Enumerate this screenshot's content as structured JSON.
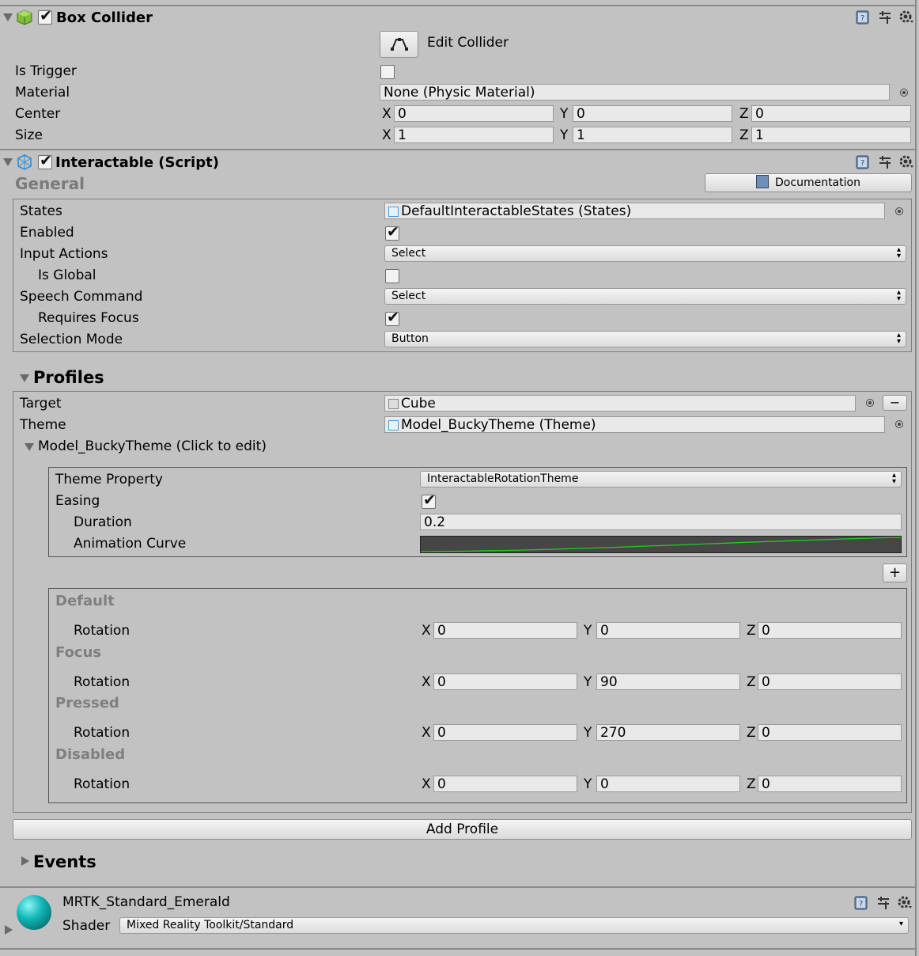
{
  "box_collider": {
    "title": "Box Collider",
    "edit_collider_label": "Edit Collider",
    "is_trigger_label": "Is Trigger",
    "material_label": "Material",
    "material_value": "None (Physic Material)",
    "center_label": "Center",
    "size_label": "Size",
    "center": {
      "x": "0",
      "y": "0",
      "z": "0"
    },
    "size": {
      "x": "1",
      "y": "1",
      "z": "1"
    }
  },
  "interactable": {
    "title": "Interactable (Script)",
    "general_label": "General",
    "documentation_label": "Documentation",
    "states_label": "States",
    "states_value": "DefaultInteractableStates (States)",
    "enabled_label": "Enabled",
    "input_actions_label": "Input Actions",
    "input_actions_value": "Select",
    "is_global_label": "Is Global",
    "speech_command_label": "Speech Command",
    "speech_command_value": "Select",
    "requires_focus_label": "Requires Focus",
    "selection_mode_label": "Selection Mode",
    "selection_mode_value": "Button"
  },
  "profiles": {
    "title": "Profiles",
    "target_label": "Target",
    "target_value": "Cube",
    "theme_label": "Theme",
    "theme_value": "Model_BuckyTheme (Theme)",
    "theme_foldout": "Model_BuckyTheme (Click to edit)",
    "minus_label": "−",
    "plus_label": "+",
    "theme_property_label": "Theme Property",
    "theme_property_value": "InteractableRotationTheme",
    "easing_label": "Easing",
    "duration_label": "Duration",
    "duration_value": "0.2",
    "animation_curve_label": "Animation Curve",
    "rotation_label": "Rotation",
    "states": [
      {
        "name": "Default",
        "x": "0",
        "y": "0",
        "z": "0"
      },
      {
        "name": "Focus",
        "x": "0",
        "y": "90",
        "z": "0"
      },
      {
        "name": "Pressed",
        "x": "0",
        "y": "270",
        "z": "0"
      },
      {
        "name": "Disabled",
        "x": "0",
        "y": "0",
        "z": "0"
      }
    ],
    "add_profile_label": "Add Profile"
  },
  "events": {
    "title": "Events"
  },
  "material": {
    "name": "MRTK_Standard_Emerald",
    "shader_label": "Shader",
    "shader_value": "Mixed Reality Toolkit/Standard"
  },
  "axes": {
    "x": "X",
    "y": "Y",
    "z": "Z"
  },
  "icons": {
    "help": "help-book-icon",
    "presets": "presets-sliders-icon",
    "settings": "gear-icon",
    "object_picker": "object-picker-target-icon"
  },
  "colors": {
    "panel_bg": "#c2c2c2",
    "curve_bg": "#464646",
    "curve_line": "#1ecf1e",
    "sphere": "#12b8b8"
  }
}
